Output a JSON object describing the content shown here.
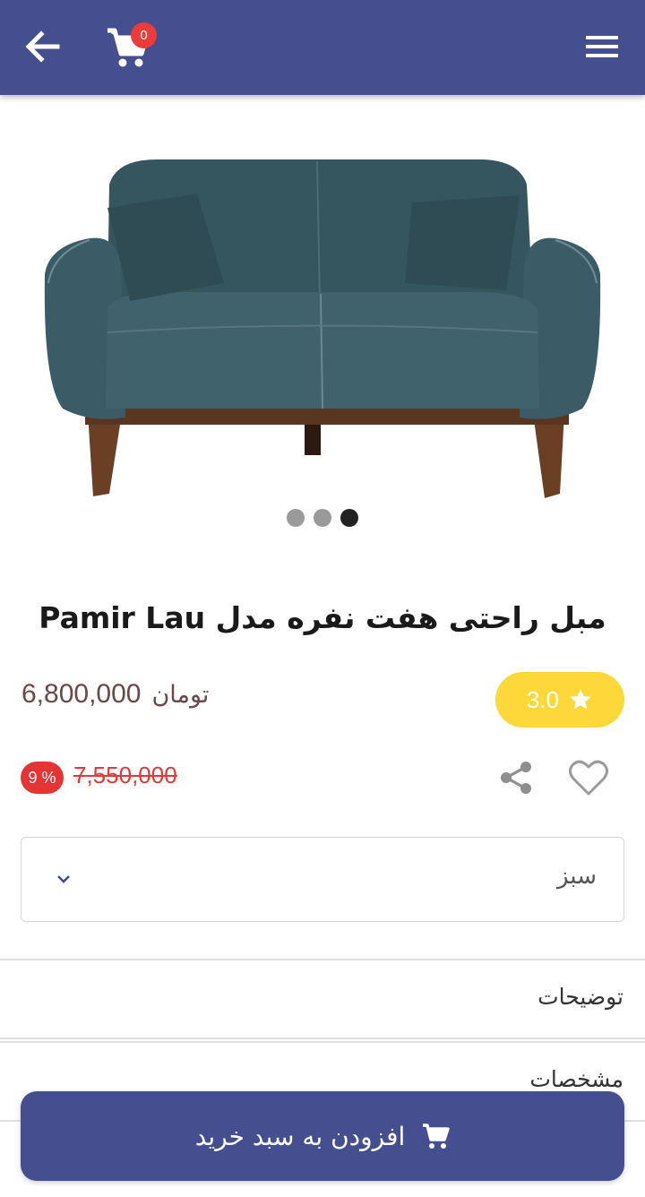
{
  "header": {
    "back_icon": "arrow-left-icon",
    "cart_icon": "shopping-cart-icon",
    "cart_count": "0",
    "menu_icon": "hamburger-menu-icon",
    "background_color": "#454e8f"
  },
  "gallery": {
    "image": "teal upholstered loveseat sofa with two cushions and wooden legs",
    "slide_count": 3,
    "active_slide": 3
  },
  "product": {
    "title": "مبل راحتی هفت نفره مدل Pamir Lau",
    "rating": "3.0",
    "price": "6,800,000",
    "currency": "تومان",
    "old_price": "7,550,000",
    "discount": "9 %"
  },
  "actions": {
    "share_icon": "share-icon",
    "favorite_icon": "heart-outline-icon"
  },
  "color_select": {
    "selected": "سبز"
  },
  "sections": [
    {
      "label": "توضیحات"
    },
    {
      "label": "مشخصات"
    }
  ],
  "add_to_cart": {
    "label": "افزودن به سبد خرید"
  },
  "colors": {
    "primary": "#454e8f",
    "rating_bg": "#fcd938",
    "price_text": "#6b4848",
    "discount_red": "#e63434"
  }
}
